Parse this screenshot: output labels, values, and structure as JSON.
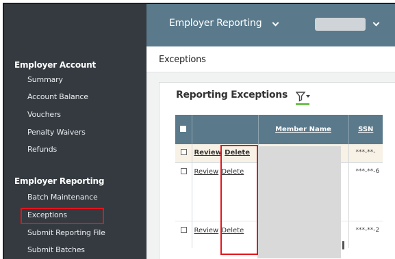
{
  "sidebar": {
    "sections": [
      {
        "title": "Employer Account",
        "items": [
          "Summary",
          "Account Balance",
          "Vouchers",
          "Penalty Waivers",
          "Refunds"
        ]
      },
      {
        "title": "Employer Reporting",
        "items": [
          "Batch Maintenance",
          "Exceptions",
          "Submit Reporting File",
          "Submit Batches"
        ]
      }
    ]
  },
  "topbar": {
    "nav_title": "Employer Reporting"
  },
  "main": {
    "page_title": "Exceptions",
    "card_title": "Reporting Exceptions",
    "table": {
      "columns": [
        "Member Name",
        "SSN"
      ],
      "rows": [
        {
          "review": "Review",
          "delete": "Delete",
          "ssn": "***-**-"
        },
        {
          "review": "Review",
          "delete": "Delete",
          "ssn": "***-**-6"
        },
        {
          "review": "Review",
          "delete": "Delete",
          "ssn": "***-**-2"
        }
      ]
    }
  },
  "colors": {
    "sidebar_bg": "#343a40",
    "header_bg": "#5a7a8c",
    "highlight": "#e3141b",
    "accent": "#6cc04a"
  }
}
